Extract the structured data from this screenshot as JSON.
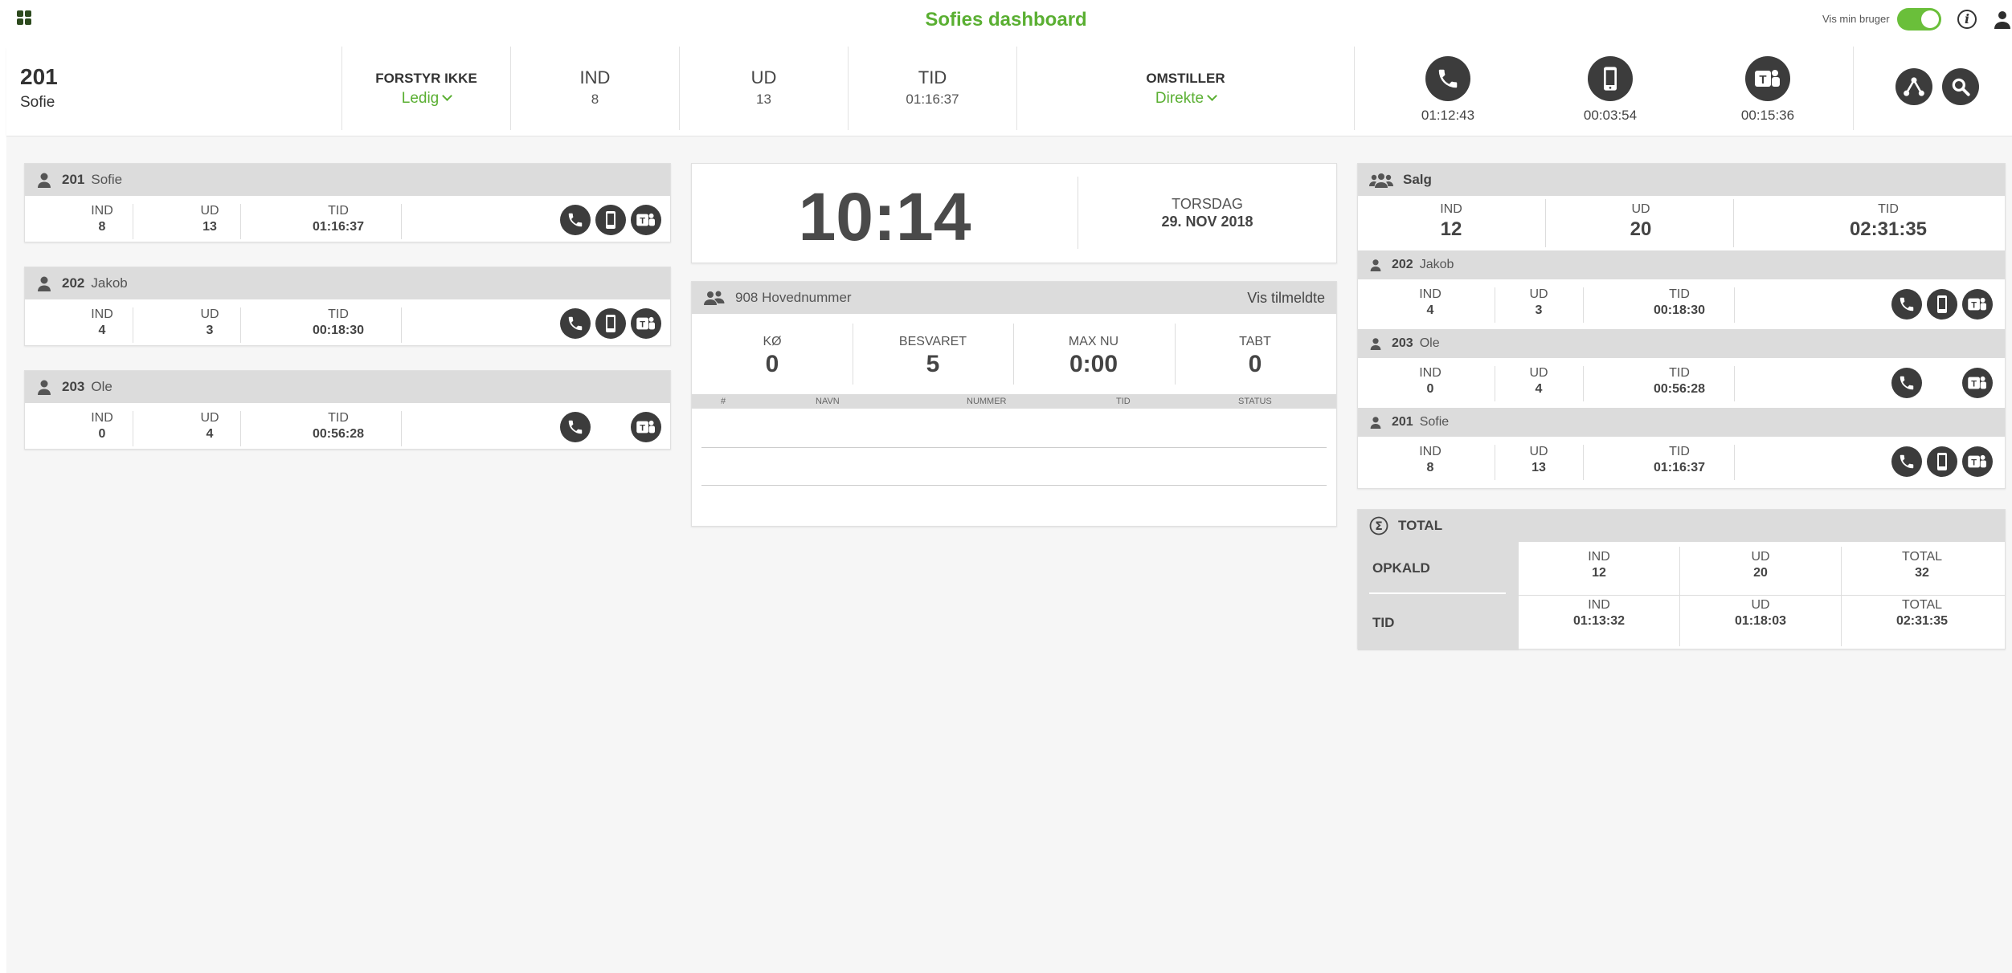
{
  "header": {
    "title": "Sofies dashboard",
    "vis_min_bruger": "Vis min bruger",
    "toggle_on": true
  },
  "me": {
    "ext": "201",
    "name": "Sofie",
    "forstyr_label": "FORSTYR IKKE",
    "forstyr_value": "Ledig",
    "ind_label": "IND",
    "ind_value": "8",
    "ud_label": "UD",
    "ud_value": "13",
    "tid_label": "TID",
    "tid_value": "01:16:37",
    "omstiller_label": "OMSTILLER",
    "omstiller_value": "Direkte",
    "devices": [
      {
        "icon": "phone-icon",
        "time": "01:12:43"
      },
      {
        "icon": "mobile-icon",
        "time": "00:03:54"
      },
      {
        "icon": "teams-icon",
        "time": "00:15:36"
      }
    ]
  },
  "left_users": [
    {
      "ext": "201",
      "name": "Sofie",
      "ind_label": "IND",
      "ind": "8",
      "ud_label": "UD",
      "ud": "13",
      "tid_label": "TID",
      "tid": "01:16:37",
      "devices": [
        "phone-icon",
        "mobile-icon",
        "teams-icon"
      ]
    },
    {
      "ext": "202",
      "name": "Jakob",
      "ind_label": "IND",
      "ind": "4",
      "ud_label": "UD",
      "ud": "3",
      "tid_label": "TID",
      "tid": "00:18:30",
      "devices": [
        "phone-icon",
        "mobile-icon",
        "teams-icon"
      ]
    },
    {
      "ext": "203",
      "name": "Ole",
      "ind_label": "IND",
      "ind": "0",
      "ud_label": "UD",
      "ud": "4",
      "tid_label": "TID",
      "tid": "00:56:28",
      "devices": [
        "phone-icon",
        "teams-icon"
      ]
    }
  ],
  "clock": {
    "time": "10:14",
    "day": "TORSDAG",
    "date": "29. NOV 2018"
  },
  "queue": {
    "title": "908 Hovednummer",
    "link": "Vis tilmeldte",
    "stats": [
      {
        "label": "KØ",
        "value": "0"
      },
      {
        "label": "BESVARET",
        "value": "5"
      },
      {
        "label": "MAX NU",
        "value": "0:00"
      },
      {
        "label": "TABT",
        "value": "0"
      }
    ],
    "columns": [
      "#",
      "NAVN",
      "NUMMER",
      "TID",
      "STATUS"
    ]
  },
  "group": {
    "name": "Salg",
    "ind_label": "IND",
    "ind": "12",
    "ud_label": "UD",
    "ud": "20",
    "tid_label": "TID",
    "tid": "02:31:35",
    "members": [
      {
        "ext": "202",
        "name": "Jakob",
        "ind_label": "IND",
        "ind": "4",
        "ud_label": "UD",
        "ud": "3",
        "tid_label": "TID",
        "tid": "00:18:30",
        "devices": [
          "phone-icon",
          "mobile-icon",
          "teams-icon"
        ]
      },
      {
        "ext": "203",
        "name": "Ole",
        "ind_label": "IND",
        "ind": "0",
        "ud_label": "UD",
        "ud": "4",
        "tid_label": "TID",
        "tid": "00:56:28",
        "devices": [
          "phone-icon",
          "teams-icon"
        ]
      },
      {
        "ext": "201",
        "name": "Sofie",
        "ind_label": "IND",
        "ind": "8",
        "ud_label": "UD",
        "ud": "13",
        "tid_label": "TID",
        "tid": "01:16:37",
        "devices": [
          "phone-icon",
          "mobile-icon",
          "teams-icon"
        ]
      }
    ]
  },
  "total": {
    "title": "TOTAL",
    "opkald_label": "OPKALD",
    "tid_label": "TID",
    "opkald": [
      {
        "label": "IND",
        "value": "12"
      },
      {
        "label": "UD",
        "value": "20"
      },
      {
        "label": "TOTAL",
        "value": "32"
      }
    ],
    "tid": [
      {
        "label": "IND",
        "value": "01:13:32"
      },
      {
        "label": "UD",
        "value": "01:18:03"
      },
      {
        "label": "TOTAL",
        "value": "02:31:35"
      }
    ]
  },
  "colors": {
    "accent_green": "#5aaf32",
    "icon_dark": "#3c3c3c",
    "header_gray": "#dcdcdc"
  }
}
